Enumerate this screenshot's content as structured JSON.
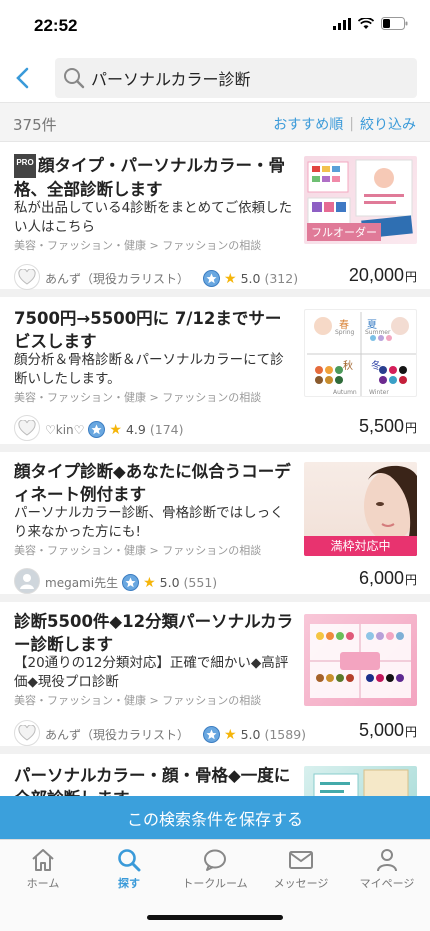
{
  "status": {
    "time": "22:52"
  },
  "search": {
    "query": "パーソナルカラー診断"
  },
  "results": {
    "count": "375件",
    "sort_label": "おすすめ順",
    "filter_label": "絞り込み"
  },
  "listings": [
    {
      "pro": "PRO",
      "title": "顔タイプ・パーソナルカラー・骨格、全部診断します",
      "description": "私が出品している4診断をまとめてご依頼したい人はこちら",
      "category": "美容・ファッション・健康 > ファッションの相談",
      "seller": "あんず（現役カラリスト）",
      "rating": "5.0",
      "reviews": "(312)",
      "price": "20,000",
      "currency": "円",
      "thumb_caption": "フルオーダー"
    },
    {
      "title": "7500円→5500円に 7/12までサービスします",
      "description": "顔分析＆骨格診断＆パーソナルカラーにて診断いしたします。",
      "category": "美容・ファッション・健康 > ファッションの相談",
      "seller": "♡kin♡",
      "rating": "4.9",
      "reviews": "(174)",
      "price": "5,500",
      "currency": "円",
      "thumb_labels": [
        "春",
        "夏",
        "秋",
        "冬"
      ],
      "thumb_sublabels": [
        "Spring",
        "Summer",
        "Autumn",
        "Winter"
      ]
    },
    {
      "title": "顔タイプ診断◆あなたに似合うコーディネート例付ます",
      "description": "パーソナルカラー診断、骨格診断ではしっくり来なかった方にも!",
      "category": "美容・ファッション・健康 > ファッションの相談",
      "seller": "megami先生",
      "rating": "5.0",
      "reviews": "(551)",
      "price": "6,000",
      "currency": "円",
      "thumb_caption": "満枠対応中"
    },
    {
      "title": "診断5500件◆12分類パーソナルカラー診断します",
      "description": "【20通りの12分類対応】正確で細かい◆高評価◆現役プロ診断",
      "category": "美容・ファッション・健康 > ファッションの相談",
      "seller": "あんず（現役カラリスト）",
      "rating": "5.0",
      "reviews": "(1589)",
      "price": "5,000",
      "currency": "円"
    },
    {
      "title": "パーソナルカラー・顔・骨格◆一度に全部診断します"
    }
  ],
  "save_search_label": "この検索条件を保存する",
  "tabs": [
    {
      "label": "ホーム",
      "icon": "home-icon"
    },
    {
      "label": "探す",
      "icon": "search-icon"
    },
    {
      "label": "トークルーム",
      "icon": "chat-icon"
    },
    {
      "label": "メッセージ",
      "icon": "mail-icon"
    },
    {
      "label": "マイページ",
      "icon": "person-icon"
    }
  ],
  "colors": {
    "accent": "#3a9ad9",
    "save_bar": "#3ba0dc",
    "star": "#f5b50a",
    "campaign": "#e8336f"
  }
}
